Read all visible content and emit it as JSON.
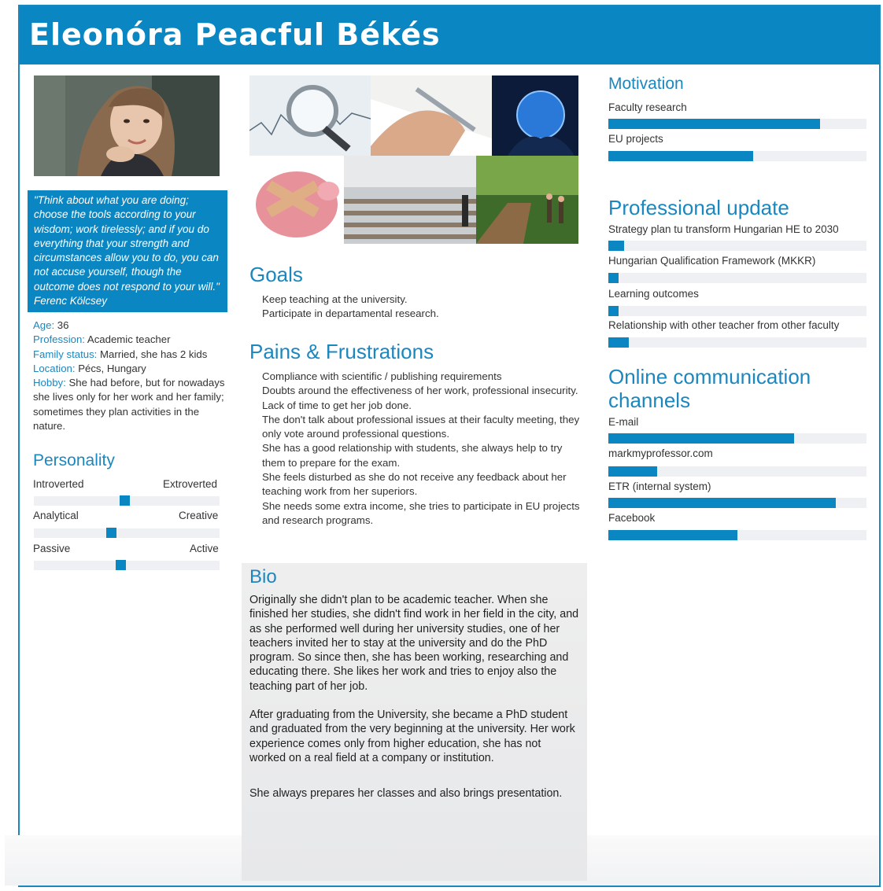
{
  "persona": {
    "name": "Eleonóra Peacful Békés",
    "quote": "\"Think about what you are doing; choose the tools according to your wisdom; work tirelessly; and if you do everything that your strength and circumstances allow you to do, you can not accuse yourself, though the outcome does not respond to your will.\"  Ferenc Kölcsey",
    "info": [
      {
        "key": "Age:",
        "value": " 36"
      },
      {
        "key": "Profession:",
        "value": " Academic teacher"
      },
      {
        "key": "Family status:",
        "value": " Married, she has 2 kids"
      },
      {
        "key": "Location:",
        "value": " Pécs, Hungary"
      },
      {
        "key": "Hobby:",
        "value": " She had before, but for nowadays she lives only for her work and her family; sometimes they plan activities in the nature."
      }
    ]
  },
  "personality": {
    "title": "Personality",
    "scales": [
      {
        "left": "Introverted",
        "right": "Extroverted",
        "level": 0.46
      },
      {
        "left": "Analytical",
        "right": "Creative",
        "level": 0.39
      },
      {
        "left": "Passive",
        "right": "Active",
        "level": 0.44
      }
    ]
  },
  "goals": {
    "title": "Goals",
    "items": [
      "Keep teaching at the university.",
      "Participate in departamental research."
    ]
  },
  "pains": {
    "title": "Pains & Frustrations",
    "items": [
      "Compliance with scientific / publishing requirements",
      "Doubts around the effectiveness of her work, professional insecurity.",
      "Lack of time to get her job done.",
      "The don't talk about professional issues at their faculty meeting, they only vote around professional questions.",
      "She has a good relationship with students, she always help to try them to prepare for the exam.",
      "She feels disturbed as she do not receive any feedback about her teaching work from her superiors.",
      "She needs some extra income, she tries to participate in EU projects and research programs."
    ]
  },
  "bio": {
    "title": "Bio",
    "paragraphs": [
      "Originally she didn't plan to be academic teacher. When she finished her studies, she didn't find work in her field in the city, and as she performed well during her university studies, one of her teachers invited her to stay at the university and do the PhD program. So  since then, she has been working, researching and educating there. She likes her work and tries to enjoy also the teaching part of her job.",
      "After graduating from the University, she became a PhD student and graduated from the very beginning at the university. Her work experience comes only from higher education, she has not worked on a real field at a company or institution.",
      "She always prepares her classes and also brings presentation."
    ]
  },
  "motivation": {
    "title": "Motivation",
    "items": [
      {
        "label": "Faculty research",
        "level": 0.82
      },
      {
        "label": "EU projects",
        "level": 0.56
      }
    ]
  },
  "professional_update": {
    "title": "Professional update",
    "items": [
      {
        "label": "Strategy plan tu transform Hungarian HE to 2030",
        "level": 0.06
      },
      {
        "label": "Hungarian Qualification Framework (MKKR)",
        "level": 0.04
      },
      {
        "label": "Learning outcomes",
        "level": 0.04
      },
      {
        "label": "Relationship with other teacher from other faculty",
        "level": 0.08
      }
    ]
  },
  "online_channels": {
    "title": "Online communication channels",
    "items": [
      {
        "label": "E-mail",
        "level": 0.72
      },
      {
        "label": "markmyprofessor.com",
        "level": 0.19
      },
      {
        "label": "ETR (internal system)",
        "level": 0.88
      },
      {
        "label": "Facebook",
        "level": 0.5
      }
    ]
  },
  "colors": {
    "accent": "#0a86c2",
    "track": "#eef0f4",
    "bio_bg": "#eeeeee"
  }
}
